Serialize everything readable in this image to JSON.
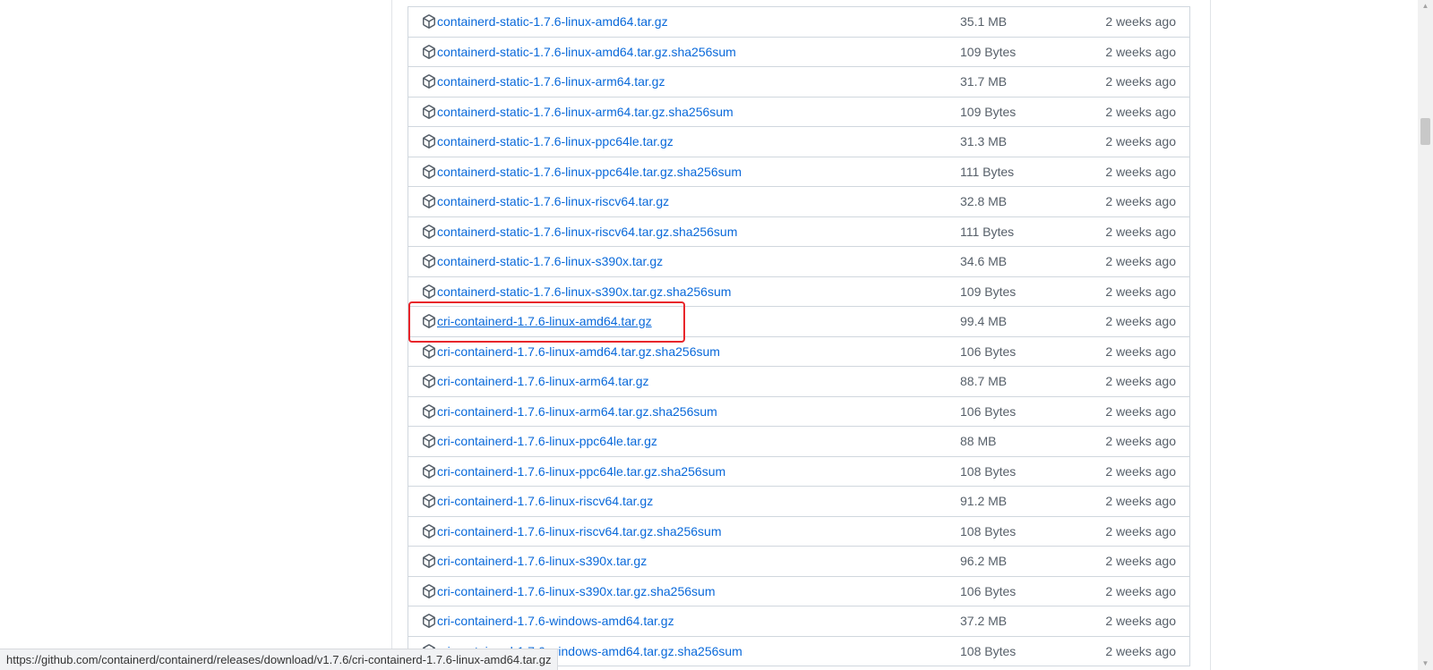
{
  "assets": [
    {
      "name": "containerd-static-1.7.6-linux-amd64.tar.gz",
      "size": "35.1 MB",
      "time": "2 weeks ago"
    },
    {
      "name": "containerd-static-1.7.6-linux-amd64.tar.gz.sha256sum",
      "size": "109 Bytes",
      "time": "2 weeks ago"
    },
    {
      "name": "containerd-static-1.7.6-linux-arm64.tar.gz",
      "size": "31.7 MB",
      "time": "2 weeks ago"
    },
    {
      "name": "containerd-static-1.7.6-linux-arm64.tar.gz.sha256sum",
      "size": "109 Bytes",
      "time": "2 weeks ago"
    },
    {
      "name": "containerd-static-1.7.6-linux-ppc64le.tar.gz",
      "size": "31.3 MB",
      "time": "2 weeks ago"
    },
    {
      "name": "containerd-static-1.7.6-linux-ppc64le.tar.gz.sha256sum",
      "size": "111 Bytes",
      "time": "2 weeks ago"
    },
    {
      "name": "containerd-static-1.7.6-linux-riscv64.tar.gz",
      "size": "32.8 MB",
      "time": "2 weeks ago"
    },
    {
      "name": "containerd-static-1.7.6-linux-riscv64.tar.gz.sha256sum",
      "size": "111 Bytes",
      "time": "2 weeks ago"
    },
    {
      "name": "containerd-static-1.7.6-linux-s390x.tar.gz",
      "size": "34.6 MB",
      "time": "2 weeks ago"
    },
    {
      "name": "containerd-static-1.7.6-linux-s390x.tar.gz.sha256sum",
      "size": "109 Bytes",
      "time": "2 weeks ago"
    },
    {
      "name": "cri-containerd-1.7.6-linux-amd64.tar.gz",
      "size": "99.4 MB",
      "time": "2 weeks ago",
      "hovered": true,
      "highlighted": true
    },
    {
      "name": "cri-containerd-1.7.6-linux-amd64.tar.gz.sha256sum",
      "size": "106 Bytes",
      "time": "2 weeks ago"
    },
    {
      "name": "cri-containerd-1.7.6-linux-arm64.tar.gz",
      "size": "88.7 MB",
      "time": "2 weeks ago"
    },
    {
      "name": "cri-containerd-1.7.6-linux-arm64.tar.gz.sha256sum",
      "size": "106 Bytes",
      "time": "2 weeks ago"
    },
    {
      "name": "cri-containerd-1.7.6-linux-ppc64le.tar.gz",
      "size": "88 MB",
      "time": "2 weeks ago"
    },
    {
      "name": "cri-containerd-1.7.6-linux-ppc64le.tar.gz.sha256sum",
      "size": "108 Bytes",
      "time": "2 weeks ago"
    },
    {
      "name": "cri-containerd-1.7.6-linux-riscv64.tar.gz",
      "size": "91.2 MB",
      "time": "2 weeks ago"
    },
    {
      "name": "cri-containerd-1.7.6-linux-riscv64.tar.gz.sha256sum",
      "size": "108 Bytes",
      "time": "2 weeks ago"
    },
    {
      "name": "cri-containerd-1.7.6-linux-s390x.tar.gz",
      "size": "96.2 MB",
      "time": "2 weeks ago"
    },
    {
      "name": "cri-containerd-1.7.6-linux-s390x.tar.gz.sha256sum",
      "size": "106 Bytes",
      "time": "2 weeks ago"
    },
    {
      "name": "cri-containerd-1.7.6-windows-amd64.tar.gz",
      "size": "37.2 MB",
      "time": "2 weeks ago"
    },
    {
      "name": "cri-containerd-1.7.6-windows-amd64.tar.gz.sha256sum",
      "size": "108 Bytes",
      "time": "2 weeks ago"
    }
  ],
  "status_bar": {
    "url": "https://github.com/containerd/containerd/releases/download/v1.7.6/cri-containerd-1.7.6-linux-amd64.tar.gz"
  },
  "icons": {
    "asset": "package-icon",
    "scroll_up": "scroll-up-arrow-icon",
    "scroll_down": "scroll-down-arrow-icon"
  },
  "colors": {
    "link": "#0969da",
    "muted": "#57606a",
    "border": "#d0d7de",
    "highlight": "#e8262b",
    "status_bar_bg": "#f1f2f4"
  }
}
